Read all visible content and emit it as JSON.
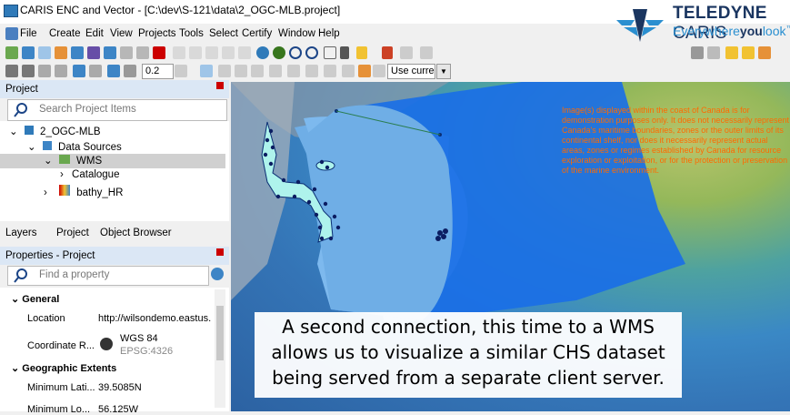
{
  "window": {
    "title": "CARIS ENC and Vector - [C:\\dev\\S-121\\data\\2_OGC-MLB.project]"
  },
  "logo": {
    "brand_bold": "TELEDYNE",
    "brand_light": "CARIS",
    "tagline_pre": "Everywhere",
    "tagline_bold": "you",
    "tagline_post": "look",
    "tagline_mark": "™"
  },
  "menu": [
    "File",
    "Create",
    "Edit",
    "View",
    "Projects",
    "Tools",
    "Select",
    "Certify",
    "Window",
    "Help"
  ],
  "toolbar": {
    "scale_value": "0.2",
    "use_current": "Use currer"
  },
  "project_panel": {
    "title": "Project",
    "search_placeholder": "Search Project Items",
    "tree": {
      "root": "2_OGC-MLB",
      "data_sources": "Data Sources",
      "wms": "WMS",
      "catalogue": "Catalogue",
      "bathy": "bathy_HR"
    }
  },
  "tabs": [
    "Layers",
    "Project",
    "Object Browser"
  ],
  "properties_panel": {
    "title": "Properties - Project",
    "search_placeholder": "Find a property",
    "general_label": "General",
    "location_label": "Location",
    "location_value": "http://wilsondemo.eastus...",
    "coord_label": "Coordinate R...",
    "coord_value": "WGS 84",
    "coord_code": "EPSG:4326",
    "geo_label": "Geographic Extents",
    "minlat_label": "Minimum Lati...",
    "minlat_value": "39.5085N",
    "minlon_label": "Minimum Lo...",
    "minlon_value": "56.125W"
  },
  "map": {
    "disclaimer": "Image(s) displayed within the coast of Canada is for demonstration purposes only. It does not necessarily represent Canada's maritime boundaries, zones or the outer limits of its continental shelf, nor does it necessarily represent actual areas, zones or regimes established by Canada for resource exploration or exploitation, or for the protection or preservation of the marine environment.",
    "caption_lines": [
      "A second connection, this time to a WMS",
      "allows us to visualize a similar CHS dataset",
      "being served from a separate client server."
    ]
  },
  "colors": {
    "accent": "#1a3560",
    "tagline": "#2a8fd0",
    "selection": "#d0d0d0",
    "panel_header": "#dbe7f5",
    "disclaimer": "#ff6a00"
  }
}
